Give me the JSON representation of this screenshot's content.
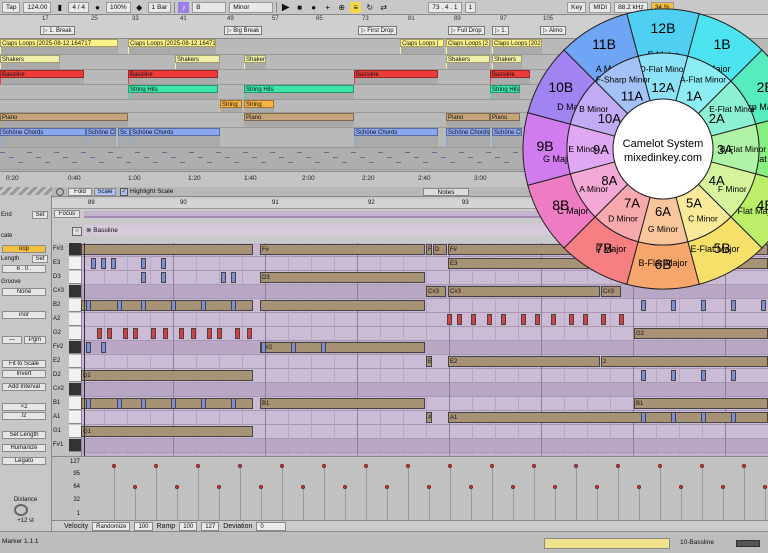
{
  "toolbar": {
    "tap": "Tap",
    "bpm": "124.00",
    "sig": "4 / 4",
    "zoom": "100%",
    "quant": "1 Bar",
    "key_root": "B",
    "scale": "Minor",
    "position": "73 .  4 .  1",
    "key_label": "Key",
    "midi_label": "MIDI",
    "sample_rate": "88.2 kHz",
    "cpu": "34 %",
    "pos2": "1"
  },
  "arrangement": {
    "ruler_numbers": [
      "17",
      "25",
      "33",
      "41",
      "49",
      "57",
      "65",
      "73",
      "81",
      "89",
      "97",
      "105"
    ],
    "locators": [
      {
        "label": "1. Break"
      },
      {
        "label": "Big Break"
      },
      {
        "label": "First Drop"
      },
      {
        "label": "Full Drop"
      },
      {
        "label": "1."
      },
      {
        "label": "Almo"
      }
    ],
    "lanes": [
      {
        "name": "claps",
        "color": "#fff38a",
        "clips": [
          {
            "label": "Claps Loops [2025-08-12 164717"
          },
          {
            "label": "Claps Loops [2025-08-12 16471"
          },
          {
            "label": "Claps Loops ["
          },
          {
            "label": "Claps Loops [2"
          },
          {
            "label": "Claps Loops [2025-08-12"
          }
        ]
      },
      {
        "name": "shakers",
        "color": "#f0f0a8",
        "clips": [
          {
            "label": "Shakers"
          },
          {
            "label": "Shakers"
          },
          {
            "label": "Shaker"
          },
          {
            "label": "Shakers"
          },
          {
            "label": "Shakers"
          }
        ]
      },
      {
        "name": "bassline",
        "color": "#ee3b3b",
        "clips": [
          {
            "label": "Bassline"
          },
          {
            "label": "Bassline"
          },
          {
            "label": "Bassline"
          },
          {
            "label": "Bassline"
          }
        ]
      },
      {
        "name": "strings",
        "color": "#3de6a8",
        "clips": [
          {
            "label": "String Hits"
          },
          {
            "label": "String Hits"
          },
          {
            "label": "String Hits"
          }
        ]
      },
      {
        "name": "strings2",
        "color": "#f5b342",
        "clips": [
          {
            "label": "String"
          },
          {
            "label": "String"
          }
        ]
      },
      {
        "name": "piano",
        "color": "#c4a57a",
        "clips": [
          {
            "label": "Piano"
          },
          {
            "label": "Piano"
          },
          {
            "label": "Piano"
          },
          {
            "label": "Piano"
          }
        ]
      },
      {
        "name": "chords",
        "color": "#8ba6f0",
        "clips": [
          {
            "label": "Schöne Chords"
          },
          {
            "label": "Schöne Ch"
          },
          {
            "label": "Sc"
          },
          {
            "label": "Schöne Chords"
          },
          {
            "label": "Schöne Chords"
          },
          {
            "label": "Schöne Chords"
          },
          {
            "label": "Schöne Chords"
          }
        ]
      }
    ],
    "time_labels": [
      "0:20",
      "0:40",
      "1:00",
      "1:20",
      "1:40",
      "2:00",
      "2:20",
      "2:40",
      "3:00"
    ]
  },
  "clip_view": {
    "fold": "Fold",
    "scale": "Scale",
    "highlight": "Highlight Scale",
    "notes_tab": "Notes",
    "focus": "Focus",
    "clip_name": "Bassline",
    "bars": [
      "89",
      "90",
      "91",
      "92",
      "93"
    ]
  },
  "left_panel": {
    "end_label": "End",
    "set": "Set",
    "cate": "cate",
    "loop": "oop",
    "length_label": "Length",
    "length_val": "8 .  0 .",
    "groove_label": "Groove",
    "groove_val": "None",
    "scale_mode": "inor",
    "pgm": "Pgm",
    "fit": "Fit to Scale",
    "invert": "Invert",
    "add_interval": "Add Interval",
    "x2": "×2",
    "div2": "/2",
    "set_length": "Set Length",
    "humanize": "Humanize",
    "legato": "Legato",
    "distance": "Distance",
    "dist_val": "+12 st"
  },
  "piano_roll": {
    "keys": [
      "F#3",
      "E3",
      "D3",
      "C#3",
      "B2",
      "A2",
      "G2",
      "F#2",
      "E2",
      "D2",
      "C#2",
      "B1",
      "A1",
      "G1",
      "F#1"
    ],
    "bigNotes": [
      {
        "row": 0,
        "l": 0,
        "w": 172,
        "t": ""
      },
      {
        "row": 0,
        "l": 179,
        "w": 165,
        "t": "F#"
      },
      {
        "row": 0,
        "l": 345,
        "w": 6,
        "t": "F"
      },
      {
        "row": 0,
        "l": 352,
        "w": 14,
        "t": "D"
      },
      {
        "row": 0,
        "l": 367,
        "w": 320,
        "t": "F#"
      },
      {
        "row": 1,
        "l": 367,
        "w": 320,
        "t": "E3"
      },
      {
        "row": 2,
        "l": 179,
        "w": 165,
        "t": "D3"
      },
      {
        "row": 3,
        "l": 345,
        "w": 20,
        "t": "C#3"
      },
      {
        "row": 3,
        "l": 367,
        "w": 152,
        "t": "C#3"
      },
      {
        "row": 3,
        "l": 520,
        "w": 20,
        "t": "C#3"
      },
      {
        "row": 4,
        "l": 0,
        "w": 172,
        "t": ""
      },
      {
        "row": 4,
        "l": 179,
        "w": 165,
        "t": ""
      },
      {
        "row": 6,
        "l": 553,
        "w": 134,
        "t": "G2"
      },
      {
        "row": 7,
        "l": 179,
        "w": 165,
        "t": "F#2"
      },
      {
        "row": 8,
        "l": 345,
        "w": 6,
        "t": "E"
      },
      {
        "row": 8,
        "l": 367,
        "w": 152,
        "t": "E2"
      },
      {
        "row": 8,
        "l": 520,
        "w": 167,
        "t": "2"
      },
      {
        "row": 9,
        "l": 0,
        "w": 172,
        "t": "D2"
      },
      {
        "row": 11,
        "l": 0,
        "w": 172,
        "t": ""
      },
      {
        "row": 11,
        "l": 179,
        "w": 165,
        "t": "B1"
      },
      {
        "row": 11,
        "l": 553,
        "w": 134,
        "t": "B1"
      },
      {
        "row": 12,
        "l": 345,
        "w": 6,
        "t": "A"
      },
      {
        "row": 12,
        "l": 367,
        "w": 320,
        "t": "A1"
      },
      {
        "row": 13,
        "l": 0,
        "w": 172,
        "t": "G1"
      }
    ],
    "velocity_ticks": [
      "127",
      "95",
      "64",
      "32",
      "1"
    ]
  },
  "bottom": {
    "velocity": "Velocity",
    "randomize": "Randomize",
    "v1": "100",
    "ramp": "Ramp",
    "r1": "100",
    "r2": "127",
    "deviation": "Deviation",
    "d1": "0"
  },
  "status": {
    "marker": "Marker 1.1.1",
    "track": "10-Bassline"
  },
  "camelot": {
    "title": "Camelot System",
    "url": "mixedinkey.com",
    "outer": [
      {
        "code": "12B",
        "key": "E Major",
        "color": "#4fd0f2"
      },
      {
        "code": "1B",
        "key": "B Major",
        "color": "#4ce4f0"
      },
      {
        "code": "2B",
        "key": "F-Sharp Major",
        "color": "#56ecc0"
      },
      {
        "code": "3B",
        "key": "D-Flat Major",
        "color": "#87ee80"
      },
      {
        "code": "4B",
        "key": "A-Flat Major",
        "color": "#bbef6a"
      },
      {
        "code": "5B",
        "key": "E-Flat Major",
        "color": "#f7e06a"
      },
      {
        "code": "6B",
        "key": "B-Flat Major",
        "color": "#f7a76c"
      },
      {
        "code": "7B",
        "key": "F Major",
        "color": "#f67f84"
      },
      {
        "code": "8B",
        "key": "C Major",
        "color": "#ee7cc2"
      },
      {
        "code": "9B",
        "key": "G Major",
        "color": "#d17cee"
      },
      {
        "code": "10B",
        "key": "D Major",
        "color": "#a184f2"
      },
      {
        "code": "11B",
        "key": "A Major",
        "color": "#6ea5f4"
      }
    ],
    "inner": [
      {
        "code": "12A",
        "key": "D-Flat Minor",
        "color": "#8ce3f7"
      },
      {
        "code": "1A",
        "key": "A-Flat Minor",
        "color": "#8cedf4"
      },
      {
        "code": "2A",
        "key": "E-Flat Minor",
        "color": "#8cf0d4"
      },
      {
        "code": "3A",
        "key": "B-Flat Minor",
        "color": "#aef3a6"
      },
      {
        "code": "4A",
        "key": "F Minor",
        "color": "#d4f39a"
      },
      {
        "code": "5A",
        "key": "C Minor",
        "color": "#f9ea9a"
      },
      {
        "code": "6A",
        "key": "G Minor",
        "color": "#f9c59b"
      },
      {
        "code": "7A",
        "key": "D Minor",
        "color": "#f8a9ae"
      },
      {
        "code": "8A",
        "key": "A Minor",
        "color": "#f3a8d6"
      },
      {
        "code": "9A",
        "key": "E Minor",
        "color": "#e0a8f3"
      },
      {
        "code": "10A",
        "key": "B Minor",
        "color": "#c1abf6"
      },
      {
        "code": "11A",
        "key": "F-Sharp Minor",
        "color": "#a4c2f7"
      }
    ]
  }
}
